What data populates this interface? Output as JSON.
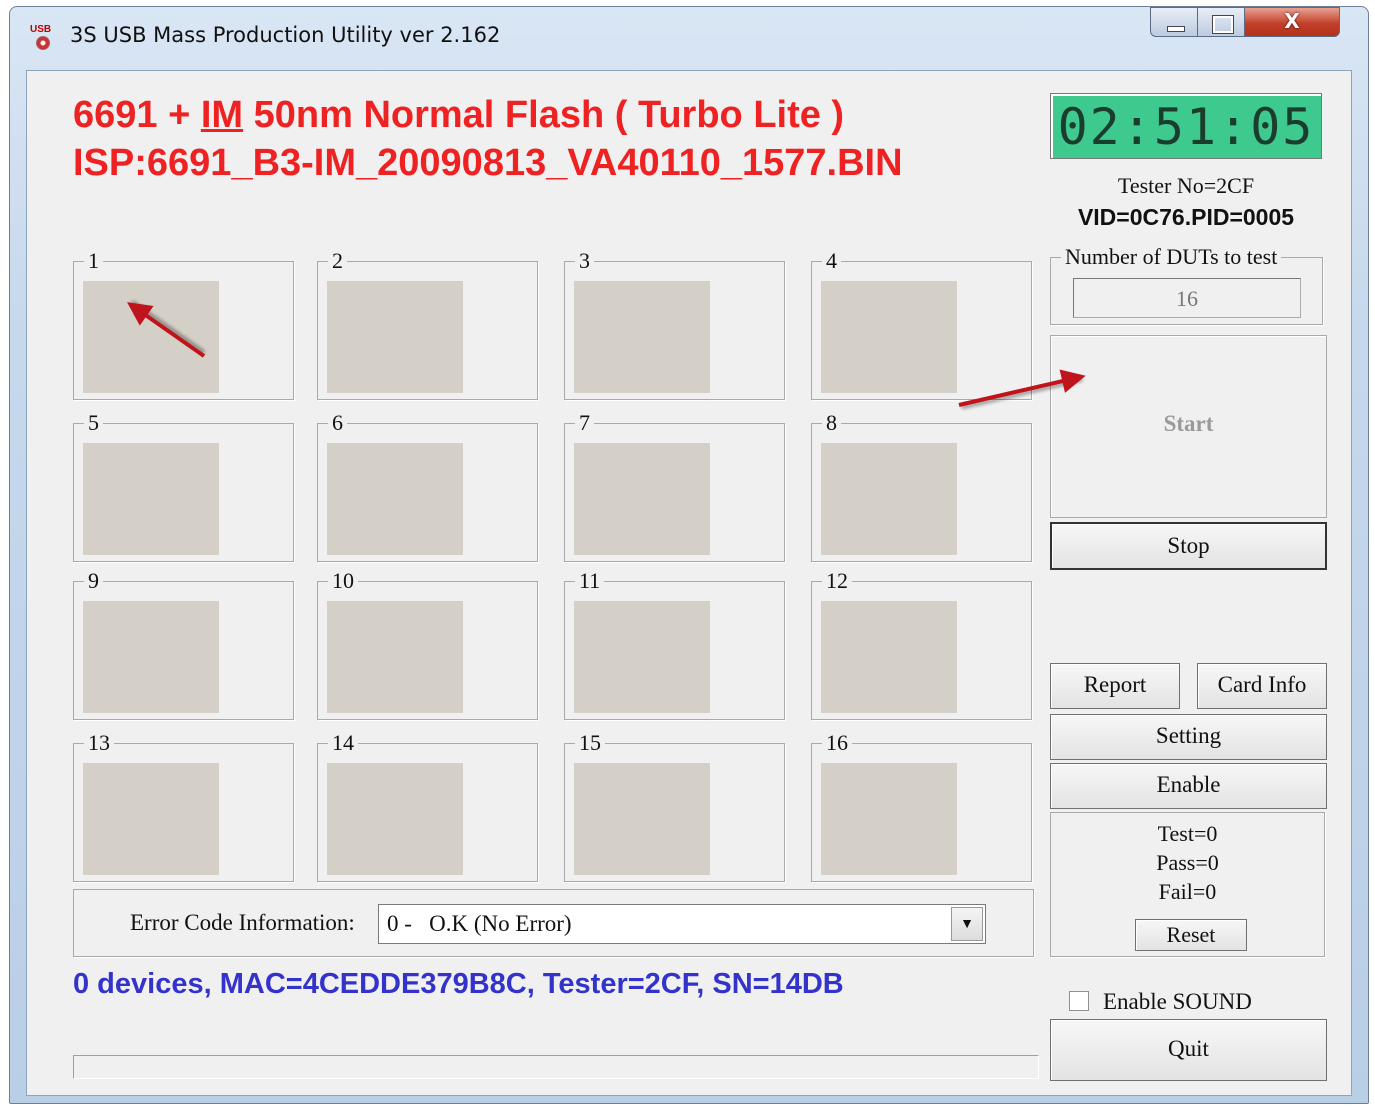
{
  "window": {
    "icon_text": "USB",
    "title": "3S USB Mass Production Utility ver 2.162",
    "close_glyph": "X"
  },
  "header": {
    "line1_prefix": "6691 + ",
    "line1_underlined": "IM",
    "line1_suffix": " 50nm Normal Flash ( Turbo Lite )",
    "line2": "ISP:6691_B3-IM_20090813_VA40110_1577.BIN"
  },
  "clock": {
    "time": "02:51:05"
  },
  "tester": {
    "tester_no": "Tester No=2CF",
    "vid_pid": "VID=0C76.PID=0005"
  },
  "duts": {
    "legend": "Number of DUTs to test",
    "value": "16"
  },
  "slots": [
    "1",
    "2",
    "3",
    "4",
    "5",
    "6",
    "7",
    "8",
    "9",
    "10",
    "11",
    "12",
    "13",
    "14",
    "15",
    "16"
  ],
  "buttons": {
    "start": "Start",
    "stop": "Stop",
    "report": "Report",
    "card_info": "Card Info",
    "setting": "Setting",
    "enable": "Enable",
    "reset": "Reset",
    "quit": "Quit"
  },
  "stats": {
    "test": "Test=0",
    "pass": "Pass=0",
    "fail": "Fail=0"
  },
  "sound": {
    "label": "Enable SOUND",
    "checked": false
  },
  "error_code": {
    "label": "Error Code Information:",
    "selected": "0 -   O.K (No Error)"
  },
  "status": {
    "device_info": "0 devices, MAC=4CEDDE379B8C, Tester=2CF, SN=14DB"
  },
  "colors": {
    "header_text": "#ee2222",
    "clock_bg": "#3ec98e",
    "status_text": "#3333cc",
    "slot_panel": "#d4d0c8",
    "annotation_arrow": "#c0141c"
  }
}
